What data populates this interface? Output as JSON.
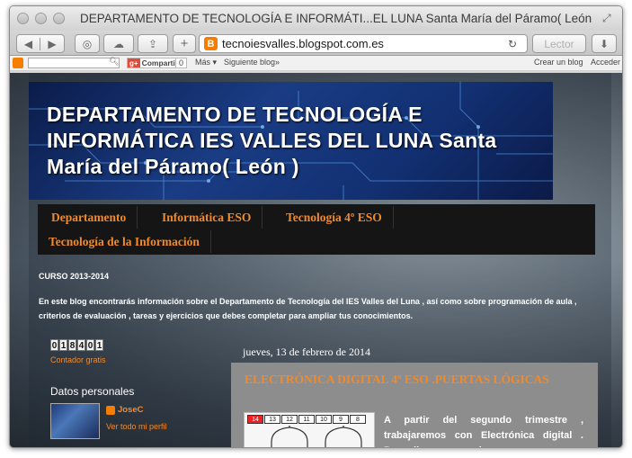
{
  "window": {
    "title": "DEPARTAMENTO DE TECNOLOGÍA E INFORMÁTI...EL LUNA Santa María del Páramo( León )"
  },
  "toolbar": {
    "url": "tecnoiesvalles.blogspot.com.es",
    "reader_label": "Lector"
  },
  "blogger_bar": {
    "share_label": "Comparti",
    "share_count": "0",
    "more_label": "Más",
    "next_blog_label": "Siguiente blog»",
    "create_blog_label": "Crear un blog",
    "login_label": "Acceder"
  },
  "header": {
    "title": "DEPARTAMENTO DE TECNOLOGÍA E INFORMÁTICA IES VALLES DEL LUNA Santa María del Páramo( León )"
  },
  "tabs": [
    {
      "label": "Departamento"
    },
    {
      "label": "Informática ESO"
    },
    {
      "label": "Tecnología 4º ESO"
    },
    {
      "label": "Tecnología de la Información"
    }
  ],
  "intro": {
    "title": "CURSO 2013-2014",
    "text": "En este blog encontrarás información sobre el Departamento de Tecnología del IES Valles del Luna , así como sobre programación de aula , criterios de evaluación , tareas y ejercicios que debes completar para ampliar tus conocimientos."
  },
  "sidebar": {
    "counter_digits": [
      "0",
      "1",
      "8",
      "4",
      "0",
      "1"
    ],
    "counter_link": "Contador gratis",
    "personal_title": "Datos personales",
    "author_name": "JoseC",
    "profile_link": "Ver todo mi perfil"
  },
  "post": {
    "date": "jueves, 13 de febrero de 2014",
    "title": "ELECTRÓNICA DIGITAL 4º ESO .PUERTAS LÓGICAS",
    "chip_pins": [
      "14",
      "13",
      "12",
      "11",
      "10",
      "9",
      "8"
    ],
    "text": "A partir del segundo trimestre , trabajaremos con Electrónica digital . Para ello es necesario"
  },
  "colors": {
    "accent": "#f08a2c",
    "nav_bg": "#151515",
    "header_bg": "#1a3c84",
    "post_bg": "#8d8d8d"
  }
}
